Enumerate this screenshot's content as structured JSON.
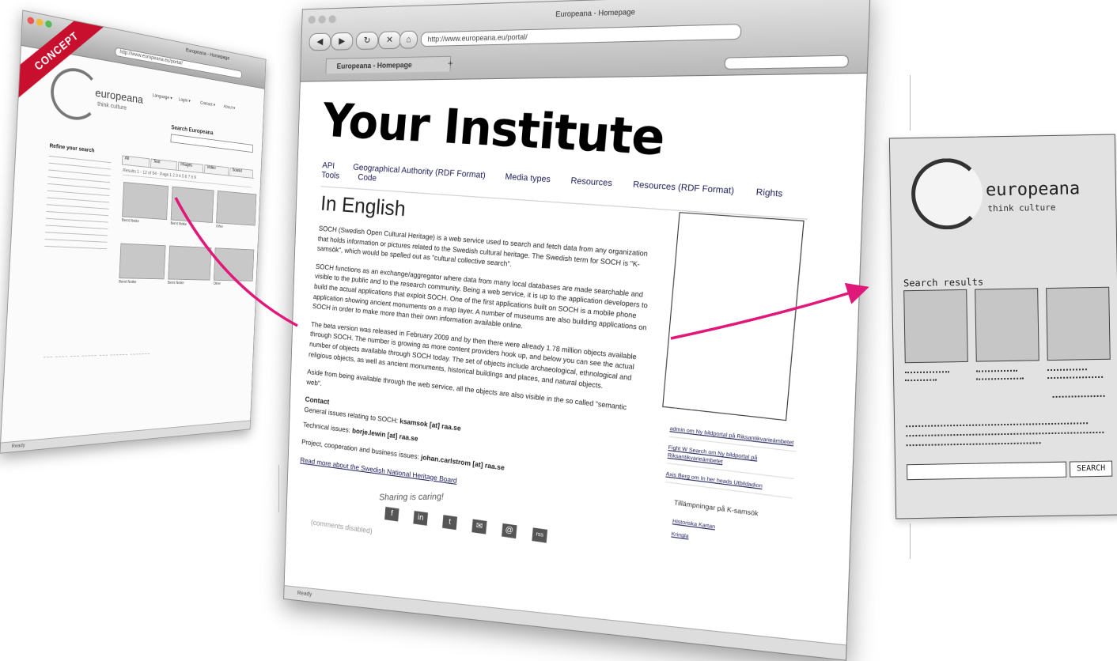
{
  "colors": {
    "arrow": "#e0187a",
    "concept_ribbon": "#c8102e"
  },
  "left_browser": {
    "ribbon": "CONCEPT",
    "url": "http://www.europeana.eu/portal/",
    "window_title": "Europeana - Homepage",
    "logo_text": "europeana",
    "logo_tagline": "think culture",
    "nav": [
      "Language ▾",
      "Login ▾",
      "Contact ▾",
      "About ▾"
    ],
    "search_label": "Search Europeana",
    "refine_title": "Refine your search",
    "tabs": [
      "All",
      "Text",
      "Images",
      "Video",
      "Sound"
    ],
    "results_bar": "Results 1 - 12 of 54 · Page 1 2 3 4 5 6 7 8 9",
    "captions": [
      "Bernt Notke",
      "Bernt Notke",
      "Other",
      "Bernt Notke",
      "Bernt Notke",
      "Other"
    ],
    "status": "Ready"
  },
  "center_browser": {
    "url": "http://www.europeana.eu/portal/",
    "window_title": "Europeana - Homepage",
    "tab_label": "Europeana - Homepage",
    "site_title": "Your Institute",
    "nav": [
      "API",
      "Geographical Authority (RDF Format)",
      "Media types",
      "Resources",
      "Resources (RDF Format)",
      "Rights",
      "Tools",
      "Code"
    ],
    "heading": "In English",
    "p1": "SOCH (Swedish Open Cultural Heritage) is a web service used to search and fetch data from any organization that holds information or pictures related to the Swedish cultural heritage. The Swedish term for SOCH is \"K-samsök\", which would be spelled out as \"cultural collective search\".",
    "p2": "SOCH functions as an exchange/aggregator where data from many local databases are made searchable and visible to the public and to the research community. Being a web service, it is up to the application developers to build the actual applications that exploit SOCH. One of the first applications built on SOCH is a mobile phone application showing ancient monuments on a map layer. A number of museums are also building applications on SOCH in order to make more than their own information available online.",
    "p3": "The beta version was released in February 2009 and by then there were already 1.78 million objects available through SOCH. The number is growing as more content providers hook up, and below you can see the actual number of objects available through SOCH today. The set of objects include archaeological, ethnological and religious objects, as well as ancient monuments, historical buildings and places, and natural objects.",
    "p4": "Aside from being available through the web service, all the objects are also visible in the so called \"semantic web\".",
    "contact_head": "Contact",
    "contact_general_label": "General issues relating to SOCH: ",
    "contact_general_email": "ksamsok [at] raa.se",
    "contact_tech_label": "Technical issues: ",
    "contact_tech_email": "borje.lewin [at] raa.se",
    "contact_project_label": "Project, cooperation and business issues: ",
    "contact_project_email": "johan.carlstrom [at] raa.se",
    "read_more": "Read more about the Swedish National Heritage Board",
    "sharing_label": "Sharing is caring!",
    "share_icons": [
      "f",
      "in",
      "t",
      "✉",
      "@",
      "rss"
    ],
    "comments": "(comments disabled)",
    "sidebar_links": [
      "admin om Ny bildportal på Riksantikvarieämbetet",
      "Fight W Search om Ny bildportal på Riksantikvarieämbetet",
      "Axis Berg om In her heads Utbildadion"
    ],
    "sidebar_section": "Tillämpningar på K-samsök",
    "sidebar_sub": [
      "Historiska Kartan",
      "Kringla"
    ],
    "status": "Ready"
  },
  "right_sketch": {
    "logo_text": "europeana",
    "logo_tagline": "think culture",
    "search_results": "Search results",
    "search_button": "SEARCH"
  }
}
